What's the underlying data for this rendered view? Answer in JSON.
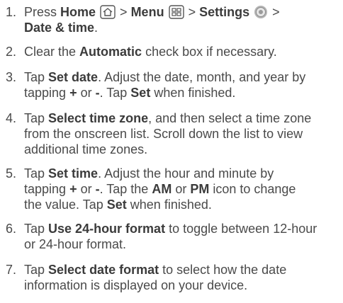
{
  "steps": [
    {
      "number": "1.",
      "parts": {
        "t1": "Press ",
        "home": "Home",
        "sep1": " > ",
        "menu": "Menu",
        "sep2": " > ",
        "settings": "Settings",
        "sep3": " >",
        "datetime": "Date & time",
        "end": "."
      },
      "icons": [
        "home-icon",
        "menu-icon",
        "settings-icon"
      ]
    },
    {
      "number": "2.",
      "parts": {
        "t1": "Clear the ",
        "automatic": "Automatic",
        "t2": " check box if necessary."
      }
    },
    {
      "number": "3.",
      "parts": {
        "t1": "Tap ",
        "set_date": "Set date",
        "t2": ". Adjust the date, month, and year by",
        "t3": "tapping ",
        "plus": "+",
        "t4": " or ",
        "minus": "-",
        "t5": ". Tap ",
        "set": "Set",
        "t6": " when finished."
      }
    },
    {
      "number": "4.",
      "parts": {
        "t1": "Tap ",
        "select_tz": "Select time zone",
        "t2": ", and then select a time zone",
        "line2": "from the onscreen list. Scroll down the list to view",
        "line3": "additional time zones."
      }
    },
    {
      "number": "5.",
      "parts": {
        "t1": "Tap ",
        "set_time": "Set time",
        "t2": ". Adjust the hour and minute by",
        "t3": "tapping ",
        "plus": "+",
        "t4": " or ",
        "minus": "-",
        "t5": ". Tap the ",
        "am": "AM",
        "t6": " or ",
        "pm": "PM",
        "t7": " icon to change",
        "t8": "the value. Tap ",
        "set": "Set",
        "t9": " when finished."
      }
    },
    {
      "number": "6.",
      "parts": {
        "t1": "Tap ",
        "use24": "Use 24-hour format",
        "t2": " to toggle between 12-hour",
        "line2": "or 24-hour format."
      }
    },
    {
      "number": "7.",
      "parts": {
        "t1": "Tap ",
        "select_df": "Select date format",
        "t2": " to select how the date",
        "line2": "information is displayed on your device."
      }
    }
  ],
  "colors": {
    "text": "#4a4a4a",
    "bold": "#3b3b3b",
    "settings_icon": "#a0a0a0"
  }
}
